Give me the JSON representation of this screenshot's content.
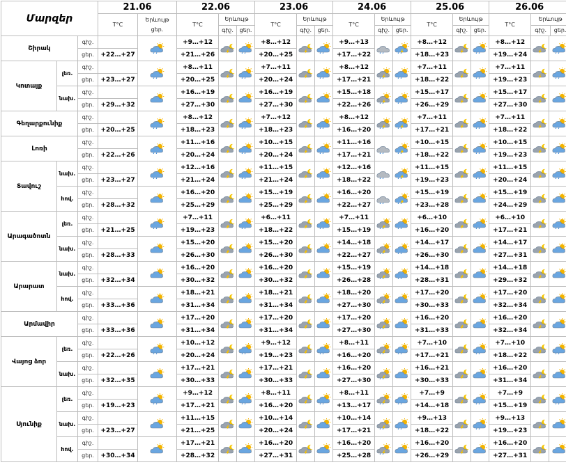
{
  "header": {
    "region_label": "Մարզեր",
    "temp_label": "T°C",
    "phen_label": "Երևույթ",
    "night_short": "գիշ.",
    "day_short": "ցեր."
  },
  "dates": [
    "21.06",
    "22.06",
    "23.06",
    "24.06",
    "25.06",
    "26.06"
  ],
  "icon_types": {
    "s": "cloud-sun-icon",
    "r": "cloud-sun-rain-icon",
    "t": "cloud-storm-icon",
    "m": "cloud-moon-icon",
    "g": "gray-cloud-rain-icon",
    "c": "cloud-thunder-rain-icon"
  },
  "regions": [
    {
      "name": "Շիրակ",
      "subs": [
        {
          "name": "",
          "night": [
            "",
            "+9…+12",
            "+8…+12",
            "+9…+13",
            "+8…+12",
            "+8…+12"
          ],
          "day": [
            "+22…+27",
            "+21…+26",
            "+20…+25",
            "+17…+22",
            "+18…+23",
            "+19…+24"
          ],
          "icons": [
            "r",
            "m",
            "r",
            "m",
            "r",
            "g",
            "c",
            "m",
            "r",
            "m",
            "r"
          ]
        }
      ]
    },
    {
      "name": "Կոտայք",
      "subs": [
        {
          "name": "լեռ.",
          "night": [
            "",
            "+8…+11",
            "+7…+11",
            "+8…+12",
            "+7…+11",
            "+7…+11"
          ],
          "day": [
            "+23…+27",
            "+20…+25",
            "+20…+24",
            "+17…+21",
            "+18…+22",
            "+19…+23"
          ],
          "icons": [
            "r",
            "m",
            "r",
            "m",
            "r",
            "t",
            "r",
            "m",
            "r",
            "m",
            "r"
          ]
        },
        {
          "name": "նախ.",
          "night": [
            "",
            "+16…+19",
            "+16…+19",
            "+15…+18",
            "+15…+17",
            "+15…+17"
          ],
          "day": [
            "+29…+32",
            "+27…+30",
            "+27…+30",
            "+22…+26",
            "+26…+29",
            "+27…+30"
          ],
          "icons": [
            "s",
            "m",
            "s",
            "m",
            "s",
            "t",
            "r",
            "m",
            "s",
            "m",
            "s"
          ]
        }
      ]
    },
    {
      "name": "Գեղարքունիք",
      "subs": [
        {
          "name": "",
          "night": [
            "",
            "+8…+12",
            "+7…+12",
            "+8…+12",
            "+7…+11",
            "+7…+11"
          ],
          "day": [
            "+20…+25",
            "+18…+23",
            "+18…+23",
            "+16…+20",
            "+17…+21",
            "+18…+22"
          ],
          "icons": [
            "r",
            "m",
            "r",
            "m",
            "r",
            "t",
            "c",
            "m",
            "r",
            "m",
            "r"
          ]
        }
      ]
    },
    {
      "name": "Լոռի",
      "subs": [
        {
          "name": "",
          "night": [
            "",
            "+11…+16",
            "+10…+15",
            "+11…+16",
            "+10…+15",
            "+10…+15"
          ],
          "day": [
            "+22…+26",
            "+20…+24",
            "+20…+24",
            "+17…+21",
            "+18…+22",
            "+19…+23"
          ],
          "icons": [
            "r",
            "m",
            "r",
            "m",
            "r",
            "g",
            "c",
            "m",
            "r",
            "m",
            "r"
          ]
        }
      ]
    },
    {
      "name": "Տավուշ",
      "subs": [
        {
          "name": "նախ.",
          "night": [
            "",
            "+12…+16",
            "+11…+15",
            "+12…+16",
            "+11…+15",
            "+11…+15"
          ],
          "day": [
            "+23…+27",
            "+21…+24",
            "+21…+24",
            "+18…+22",
            "+19…+23",
            "+20…+24"
          ],
          "icons": [
            "r",
            "m",
            "r",
            "m",
            "r",
            "g",
            "c",
            "m",
            "r",
            "m",
            "r"
          ]
        },
        {
          "name": "հով.",
          "night": [
            "",
            "+16…+20",
            "+15…+19",
            "+16…+20",
            "+15…+19",
            "+15…+19"
          ],
          "day": [
            "+28…+32",
            "+25…+29",
            "+25…+29",
            "+22…+27",
            "+23…+28",
            "+24…+29"
          ],
          "icons": [
            "s",
            "m",
            "s",
            "m",
            "s",
            "g",
            "c",
            "m",
            "s",
            "m",
            "s"
          ]
        }
      ]
    },
    {
      "name": "Արագածոտն",
      "subs": [
        {
          "name": "լեռ.",
          "night": [
            "",
            "+7…+11",
            "+6…+11",
            "+7…+11",
            "+6…+10",
            "+6…+10"
          ],
          "day": [
            "+21…+25",
            "+19…+23",
            "+18…+22",
            "+15…+19",
            "+16…+20",
            "+17…+21"
          ],
          "icons": [
            "r",
            "m",
            "r",
            "m",
            "r",
            "t",
            "r",
            "m",
            "r",
            "m",
            "r"
          ]
        },
        {
          "name": "նախ.",
          "night": [
            "",
            "+15…+20",
            "+15…+20",
            "+14…+18",
            "+14…+17",
            "+14…+17"
          ],
          "day": [
            "+28…+33",
            "+26…+30",
            "+26…+30",
            "+22…+27",
            "+26…+30",
            "+27…+31"
          ],
          "icons": [
            "s",
            "m",
            "s",
            "m",
            "s",
            "t",
            "r",
            "m",
            "s",
            "m",
            "s"
          ]
        }
      ]
    },
    {
      "name": "Արարատ",
      "subs": [
        {
          "name": "նախ.",
          "night": [
            "",
            "+16…+20",
            "+16…+20",
            "+15…+19",
            "+14…+18",
            "+14…+18"
          ],
          "day": [
            "+32…+34",
            "+30…+32",
            "+30…+32",
            "+26…+28",
            "+28…+31",
            "+29…+32"
          ],
          "icons": [
            "s",
            "m",
            "s",
            "m",
            "s",
            "t",
            "r",
            "m",
            "s",
            "m",
            "s"
          ]
        },
        {
          "name": "հով.",
          "night": [
            "",
            "+18…+21",
            "+18…+21",
            "+18…+20",
            "+17…+20",
            "+17…+20"
          ],
          "day": [
            "+33…+36",
            "+31…+34",
            "+31…+34",
            "+27…+30",
            "+30…+33",
            "+32…+34"
          ],
          "icons": [
            "s",
            "m",
            "s",
            "m",
            "s",
            "t",
            "s",
            "m",
            "s",
            "m",
            "s"
          ]
        }
      ]
    },
    {
      "name": "Արմավիր",
      "subs": [
        {
          "name": "",
          "night": [
            "",
            "+17…+20",
            "+17…+20",
            "+17…+20",
            "+16…+20",
            "+16…+20"
          ],
          "day": [
            "+33…+36",
            "+31…+34",
            "+31…+34",
            "+27…+30",
            "+31…+33",
            "+32…+34"
          ],
          "icons": [
            "s",
            "m",
            "s",
            "m",
            "s",
            "t",
            "s",
            "m",
            "s",
            "m",
            "s"
          ]
        }
      ]
    },
    {
      "name": "Վայոց ձոր",
      "subs": [
        {
          "name": "լեռ.",
          "night": [
            "",
            "+10…+12",
            "+9…+12",
            "+8…+11",
            "+7…+10",
            "+7…+10"
          ],
          "day": [
            "+22…+26",
            "+20…+24",
            "+19…+23",
            "+16…+20",
            "+17…+21",
            "+18…+22"
          ],
          "icons": [
            "r",
            "m",
            "r",
            "m",
            "r",
            "t",
            "r",
            "m",
            "r",
            "m",
            "r"
          ]
        },
        {
          "name": "նախ.",
          "night": [
            "",
            "+17…+21",
            "+17…+21",
            "+16…+20",
            "+16…+21",
            "+16…+20"
          ],
          "day": [
            "+32…+35",
            "+30…+33",
            "+30…+33",
            "+27…+30",
            "+30…+33",
            "+31…+34"
          ],
          "icons": [
            "s",
            "m",
            "s",
            "m",
            "s",
            "t",
            "s",
            "m",
            "s",
            "m",
            "s"
          ]
        }
      ]
    },
    {
      "name": "Սյունիք",
      "subs": [
        {
          "name": "լեռ.",
          "night": [
            "",
            "+9…+12",
            "+8…+11",
            "+8…+11",
            "+7…+9",
            "+7…+9"
          ],
          "day": [
            "+19…+23",
            "+17…+21",
            "+16…+20",
            "+13…+17",
            "+14…+18",
            "+15…+19"
          ],
          "icons": [
            "r",
            "m",
            "r",
            "m",
            "r",
            "t",
            "r",
            "m",
            "r",
            "m",
            "r"
          ]
        },
        {
          "name": "նախ.",
          "night": [
            "",
            "+11…+15",
            "+10…+14",
            "+10…+14",
            "+9…+13",
            "+9…+13"
          ],
          "day": [
            "+23…+27",
            "+21…+25",
            "+20…+24",
            "+17…+21",
            "+18…+22",
            "+19…+23"
          ],
          "icons": [
            "s",
            "m",
            "s",
            "m",
            "s",
            "t",
            "r",
            "m",
            "r",
            "m",
            "s"
          ]
        },
        {
          "name": "հով.",
          "night": [
            "",
            "+17…+21",
            "+16…+20",
            "+16…+20",
            "+16…+20",
            "+16…+20"
          ],
          "day": [
            "+30…+34",
            "+28…+32",
            "+27…+31",
            "+25…+28",
            "+26…+29",
            "+27…+31"
          ],
          "icons": [
            "s",
            "m",
            "s",
            "m",
            "s",
            "t",
            "s",
            "m",
            "s",
            "m",
            "s"
          ]
        }
      ]
    }
  ]
}
